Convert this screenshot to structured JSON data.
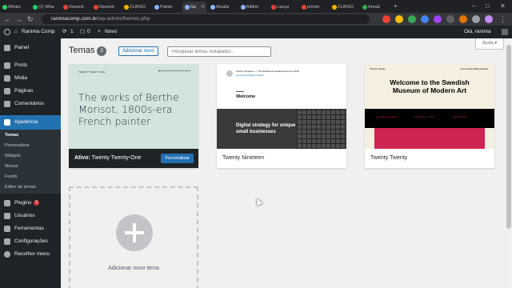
{
  "browser": {
    "tabs": [
      {
        "label": "Whats"
      },
      {
        "label": "(1) Wha"
      },
      {
        "label": "Desenh"
      },
      {
        "label": "Desenh"
      },
      {
        "label": "CURSO"
      },
      {
        "label": "Painel"
      },
      {
        "label": "Ge",
        "active": true
      },
      {
        "label": "Atualiz"
      },
      {
        "label": "Bibliot"
      },
      {
        "label": "Lança"
      },
      {
        "label": "primei"
      },
      {
        "label": "CURSO"
      },
      {
        "label": "AreaE"
      }
    ],
    "url_host": "ranimacomp.com.br",
    "url_path": "/wp-admin/themes.php",
    "new_tab": "+"
  },
  "admin_bar": {
    "site_name": "Ranima Comp",
    "updates_count": "1",
    "comments_count": "0",
    "new_label": "Novo",
    "user_greeting": "Olá, ranima"
  },
  "sidebar": {
    "items": [
      {
        "label": "Painel",
        "icon": "dashboard-icon"
      },
      {
        "label": "Posts",
        "icon": "pin-icon"
      },
      {
        "label": "Mídia",
        "icon": "media-icon"
      },
      {
        "label": "Páginas",
        "icon": "page-icon"
      },
      {
        "label": "Comentários",
        "icon": "comment-icon"
      },
      {
        "label": "Aparência",
        "icon": "brush-icon"
      },
      {
        "label": "Plugins",
        "icon": "plug-icon",
        "badge": "1"
      },
      {
        "label": "Usuários",
        "icon": "users-icon"
      },
      {
        "label": "Ferramentas",
        "icon": "wrench-icon"
      },
      {
        "label": "Configurações",
        "icon": "settings-icon"
      },
      {
        "label": "Recolher menu",
        "icon": "collapse-icon"
      }
    ],
    "submenu": [
      "Temas",
      "Personalizar",
      "Widgets",
      "Menus",
      "Fundo",
      "Editor de temas"
    ]
  },
  "main": {
    "title": "Temas",
    "theme_count": "3",
    "add_new_label": "Adicionar novo",
    "search_placeholder": "Pesquisar temas instalados...",
    "help_label": "Ajuda ▾"
  },
  "themes": {
    "active": {
      "prefix": "Ativo:",
      "name": "Twenty Twenty-One",
      "customize_label": "Personalizar",
      "site_title": "TWENTY TWENTY-ONE",
      "headline": "The works of Berthe Morisot, 1800s-era French painter"
    },
    "nineteen": {
      "name": "Twenty Nineteen",
      "site_title": "Twenty Nineteen — The WordPress default theme for 2019",
      "nav": "Home  About  Blog  Contact",
      "welcome": "Welcome",
      "hero": "Digital strategy for unique small businesses"
    },
    "twenty": {
      "name": "Twenty Twenty",
      "site_title": "Twenty Twenty",
      "nav": "Home  About  Blog  Contact",
      "headline": "Welcome to the Swedish Museum of Modern Art",
      "col1": "Dr. Kellgrens  Stockholm",
      "col2": "Hours  10:00 — 17:00",
      "col3": "Price  $20 / $18"
    }
  },
  "add_theme_label": "Adicionar novo tema",
  "watermark": "udemy",
  "colors": {
    "wp_admin_dark": "#1d2327",
    "wp_blue": "#2271b1",
    "badge_red": "#d63638"
  }
}
